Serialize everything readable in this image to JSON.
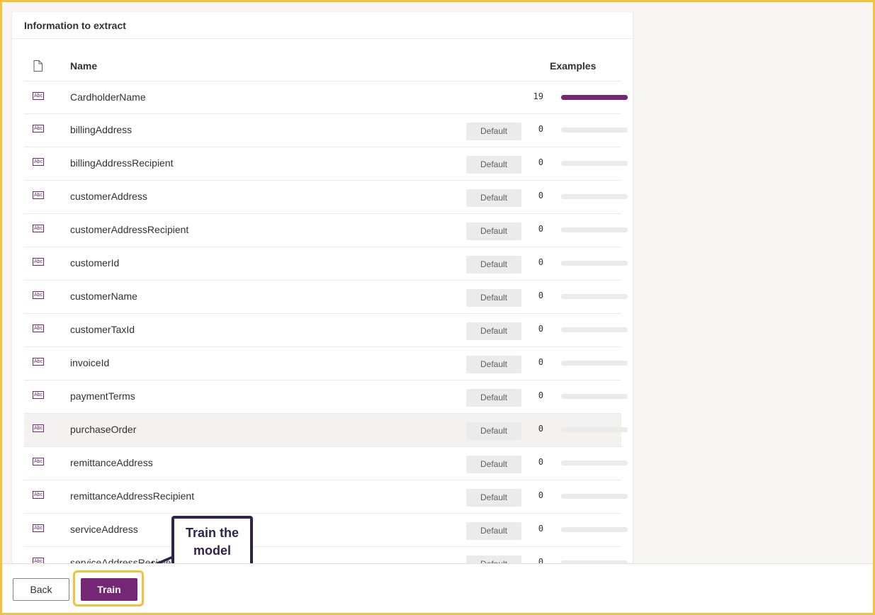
{
  "panel": {
    "title": "Information to extract",
    "columns": {
      "name": "Name",
      "examples": "Examples"
    }
  },
  "fields": [
    {
      "name": "CardholderName",
      "badge": "",
      "count": "19",
      "fraction": 1.0
    },
    {
      "name": "billingAddress",
      "badge": "Default",
      "count": "0",
      "fraction": 0
    },
    {
      "name": "billingAddressRecipient",
      "badge": "Default",
      "count": "0",
      "fraction": 0
    },
    {
      "name": "customerAddress",
      "badge": "Default",
      "count": "0",
      "fraction": 0
    },
    {
      "name": "customerAddressRecipient",
      "badge": "Default",
      "count": "0",
      "fraction": 0
    },
    {
      "name": "customerId",
      "badge": "Default",
      "count": "0",
      "fraction": 0
    },
    {
      "name": "customerName",
      "badge": "Default",
      "count": "0",
      "fraction": 0
    },
    {
      "name": "customerTaxId",
      "badge": "Default",
      "count": "0",
      "fraction": 0
    },
    {
      "name": "invoiceId",
      "badge": "Default",
      "count": "0",
      "fraction": 0
    },
    {
      "name": "paymentTerms",
      "badge": "Default",
      "count": "0",
      "fraction": 0
    },
    {
      "name": "purchaseOrder",
      "badge": "Default",
      "count": "0",
      "fraction": 0
    },
    {
      "name": "remittanceAddress",
      "badge": "Default",
      "count": "0",
      "fraction": 0
    },
    {
      "name": "remittanceAddressRecipient",
      "badge": "Default",
      "count": "0",
      "fraction": 0
    },
    {
      "name": "serviceAddress",
      "badge": "Default",
      "count": "0",
      "fraction": 0
    },
    {
      "name": "serviceAddressRecipient",
      "badge": "Default",
      "count": "0",
      "fraction": 0
    }
  ],
  "field_icon_text": "Abc",
  "footer": {
    "back_label": "Back",
    "train_label": "Train"
  },
  "callout": {
    "line1": "Train the",
    "line2": "model"
  },
  "colors": {
    "accent": "#742774",
    "highlight": "#f3c23c",
    "callout": "#32234b"
  }
}
